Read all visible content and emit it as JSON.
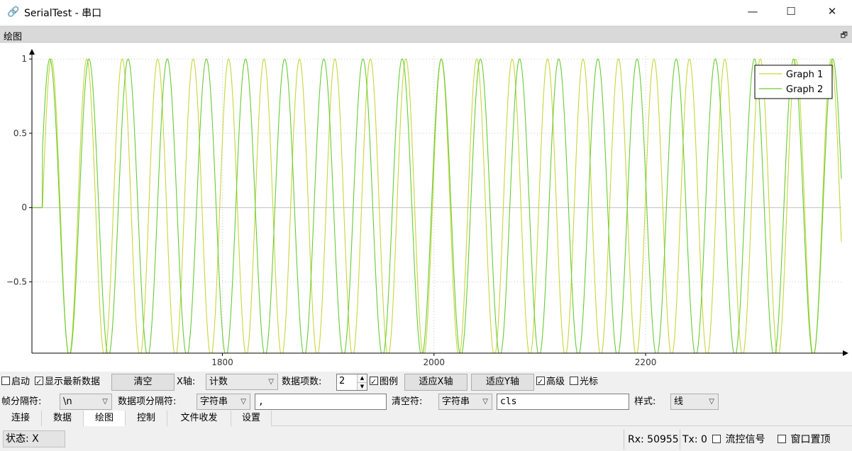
{
  "window": {
    "title": "SerialTest - 串口",
    "icon": "link-icon",
    "controls": {
      "minimize": "—",
      "maximize": "☐",
      "close": "✕"
    }
  },
  "dock": {
    "title": "绘图",
    "float_icon": "restore-icon"
  },
  "chart_data": {
    "type": "line",
    "x": {
      "ticks": [
        1800,
        2000,
        2200
      ],
      "range": [
        1620,
        2385
      ]
    },
    "y": {
      "ticks": [
        -0.5,
        0,
        0.5,
        1
      ],
      "tick_labels": [
        "−0.5",
        "0",
        "0.5",
        "1"
      ],
      "range": [
        -0.98,
        1.02
      ]
    },
    "grid": true,
    "legend_placement": "top-right",
    "series": [
      {
        "name": "Graph 1",
        "color": "#c7d63a",
        "function": "sin-like oscillation, amplitude ~1"
      },
      {
        "name": "Graph 2",
        "color": "#66cc33",
        "function": "sin-like oscillation, amplitude ~1"
      }
    ],
    "axis_color": "#000000",
    "grid_color": "#c8c8c8"
  },
  "row1": {
    "start_label": "启动",
    "start_checked": false,
    "show_latest_label": "显示最新数据",
    "show_latest_checked": true,
    "clear_button": "清空",
    "xaxis_label": "X轴:",
    "xaxis_value": "计数",
    "item_count_label": "数据项数:",
    "item_count_value": "2",
    "legend_label": "图例",
    "legend_checked": true,
    "fit_x_button": "适应X轴",
    "fit_y_button": "适应Y轴",
    "advanced_label": "高级",
    "advanced_checked": true,
    "cursor_label": "光标",
    "cursor_checked": false
  },
  "row2": {
    "frame_sep_label": "帧分隔符:",
    "frame_sep_value": "\\n",
    "item_sep_label": "数据项分隔符:",
    "item_sep_type": "字符串",
    "item_sep_value": ",",
    "clear_char_label": "清空符:",
    "clear_char_type": "字符串",
    "clear_char_value": "cls",
    "style_label": "样式:",
    "style_value": "线"
  },
  "tabs": [
    {
      "label": "连接"
    },
    {
      "label": "数据"
    },
    {
      "label": "绘图"
    },
    {
      "label": "控制"
    },
    {
      "label": "文件收发"
    },
    {
      "label": "设置"
    }
  ],
  "status": {
    "state": "状态: X",
    "rx": "Rx: 50955",
    "tx": "Tx: 0",
    "flow_label": "流控信号",
    "ontop_label": "窗口置顶"
  }
}
